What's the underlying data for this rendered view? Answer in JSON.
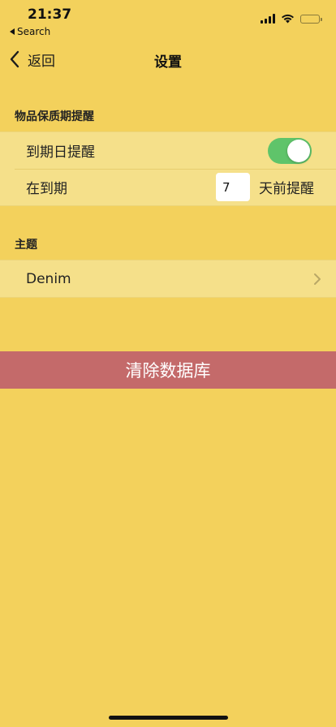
{
  "status_bar": {
    "time": "21:37",
    "back_app": "Search"
  },
  "nav": {
    "back_label": "返回",
    "title": "设置"
  },
  "sections": {
    "expiry": {
      "header": "物品保质期提醒",
      "toggle_label": "到期日提醒",
      "toggle_on": true,
      "days_prefix": "在到期",
      "days_value": "7",
      "days_suffix": "天前提醒"
    },
    "theme": {
      "header": "主题",
      "value": "Denim"
    }
  },
  "actions": {
    "clear_database": "清除数据库"
  },
  "colors": {
    "background": "#f3d15c",
    "row_background": "#f5e08a",
    "toggle_on": "#5fc46a",
    "danger": "#c46a6a"
  }
}
